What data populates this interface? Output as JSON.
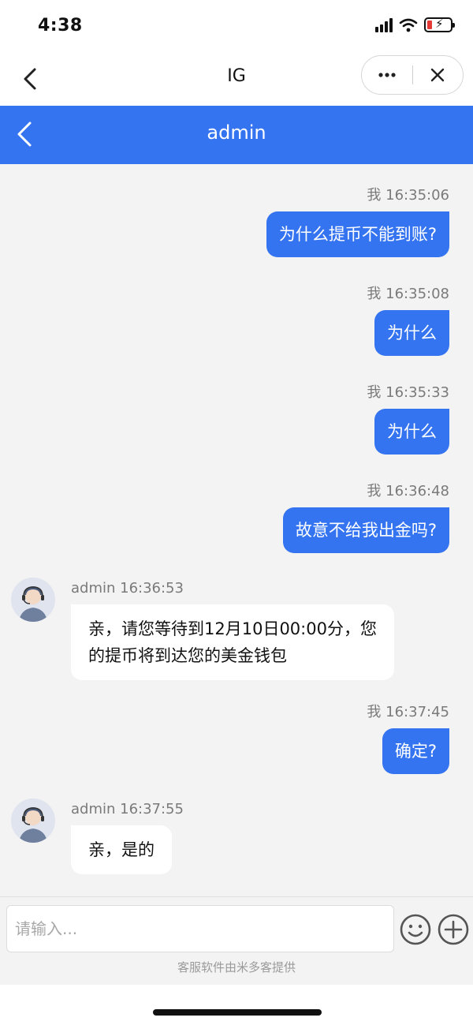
{
  "status_bar": {
    "time": "4:38"
  },
  "browser": {
    "title": "IG"
  },
  "chat": {
    "header_title": "admin",
    "messages": [
      {
        "sender": "me",
        "meta": "我 16:35:06",
        "text": "为什么提币不能到账?"
      },
      {
        "sender": "me",
        "meta": "我 16:35:08",
        "text": "为什么"
      },
      {
        "sender": "me",
        "meta": "我 16:35:33",
        "text": "为什么"
      },
      {
        "sender": "me",
        "meta": "我 16:36:48",
        "text": "故意不给我出金吗?"
      },
      {
        "sender": "admin",
        "meta": "admin 16:36:53",
        "text_line1": "亲，请您等待到12月10日00:00分，您",
        "text_line2": "的提币将到达您的美金钱包"
      },
      {
        "sender": "me",
        "meta": "我 16:37:45",
        "text": "确定?"
      },
      {
        "sender": "admin",
        "meta": "admin 16:37:55",
        "text": "亲，是的"
      }
    ]
  },
  "input": {
    "placeholder": "请输入...",
    "powered_by": "客服软件由米多客提供"
  },
  "colors": {
    "accent": "#3574f0",
    "chat_background": "#f3f3f3",
    "battery_low": "#e53935"
  },
  "icons": [
    "back-chevron-icon",
    "more-icon",
    "close-icon",
    "emoji-icon",
    "plus-icon",
    "agent-avatar-icon"
  ]
}
